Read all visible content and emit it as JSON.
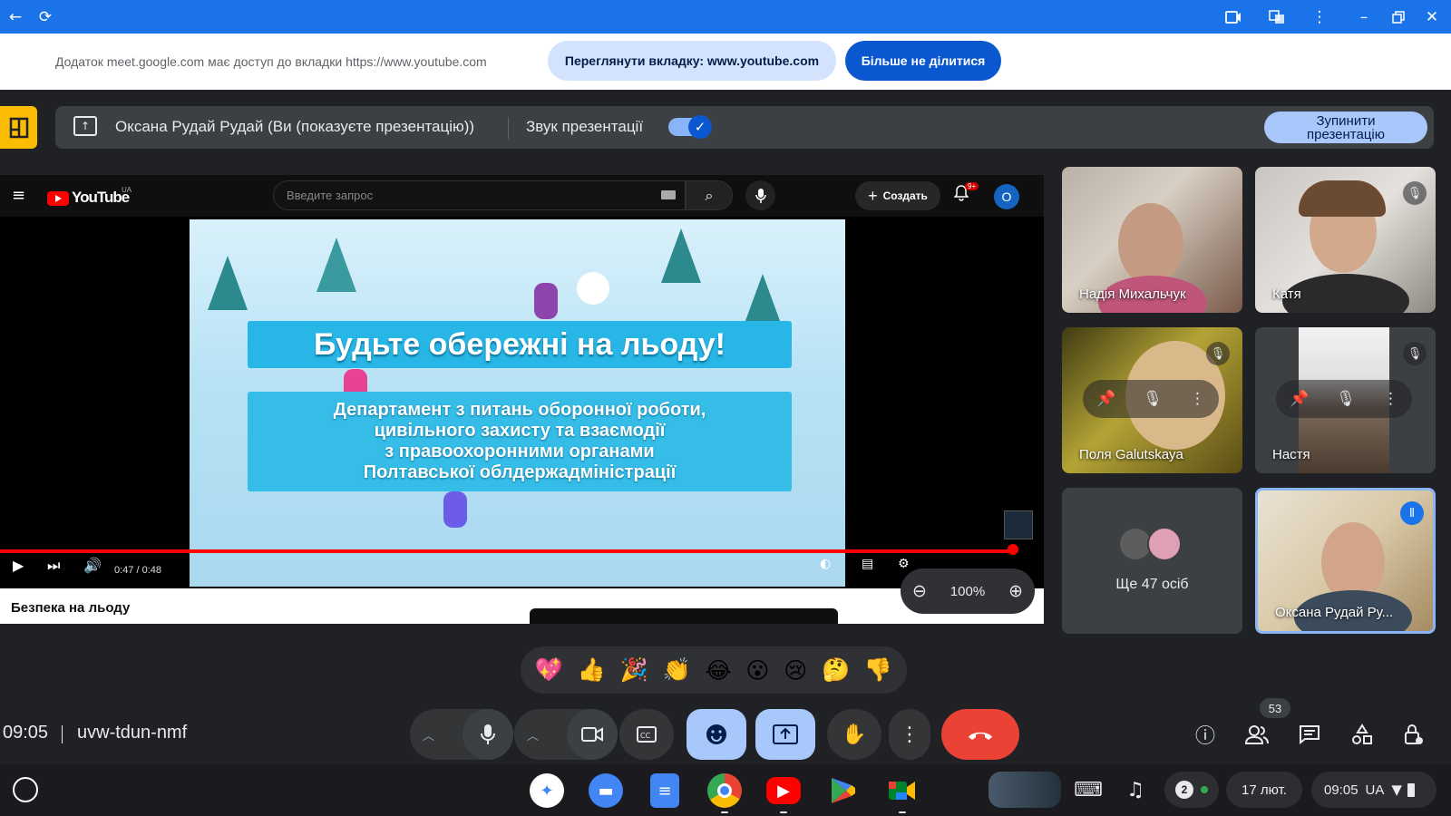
{
  "browser": {
    "back_icon": "←",
    "reload_icon": "⟳",
    "right_icons": [
      "cast-icon",
      "translate-icon",
      "kebab-icon",
      "minimize-icon",
      "restore-icon",
      "close-icon"
    ]
  },
  "share_banner": {
    "text": "Додаток meet.google.com має доступ до вкладки https://www.youtube.com",
    "view_tab_button": "Переглянути вкладку: www.youtube.com",
    "stop_sharing_button": "Більше не ділитися"
  },
  "presentation_bar": {
    "presenter_label": "Оксана Рудай Рудай (Ви (показуєте презентацію))",
    "audio_label": "Звук презентації",
    "audio_enabled": true,
    "stop_button_line1": "Зупинити",
    "stop_button_line2": "презентацію"
  },
  "youtube": {
    "logo_text": "YouTube",
    "region": "UA",
    "search_placeholder": "Введите запрос",
    "create_label": "Создать",
    "notification_badge": "9+",
    "avatar_letter": "O",
    "video_title_overlay": "Будьте обережні на льоду!",
    "video_body_lines": [
      "Департамент з питань оборонної роботи,",
      "цивільного захисту та взаємодії",
      "з правоохоронними органами",
      "Полтавської облдержадміністрації"
    ],
    "time_display": "0:47 / 0:48",
    "progress": 0.98,
    "video_title": "Безпека на льоду"
  },
  "zoom": {
    "level": "100%"
  },
  "participants": [
    {
      "name": "Надія Михальчук",
      "muted": false
    },
    {
      "name": "Катя",
      "muted": true
    },
    {
      "name": "Поля Galutskaya",
      "muted": true
    },
    {
      "name": "Настя",
      "muted": true
    },
    {
      "name": "Оксана Рудай Ру...",
      "speaking": true
    }
  ],
  "more_participants": "Ще 47 осіб",
  "reactions": [
    "💖",
    "👍",
    "🎉",
    "👏",
    "😂",
    "😮",
    "😢",
    "🤔",
    "👎"
  ],
  "meeting": {
    "time": "09:05",
    "code": "uvw-tdun-nmf",
    "participant_count": "53"
  },
  "shelf": {
    "date": "17 лют.",
    "time": "09:05",
    "locale": "UA",
    "notification_count": "2"
  },
  "colors": {
    "chrome_blue": "#1a73e8",
    "meet_dark": "#202124",
    "end_call_red": "#ea4335",
    "active_button": "#a8c7fa"
  }
}
